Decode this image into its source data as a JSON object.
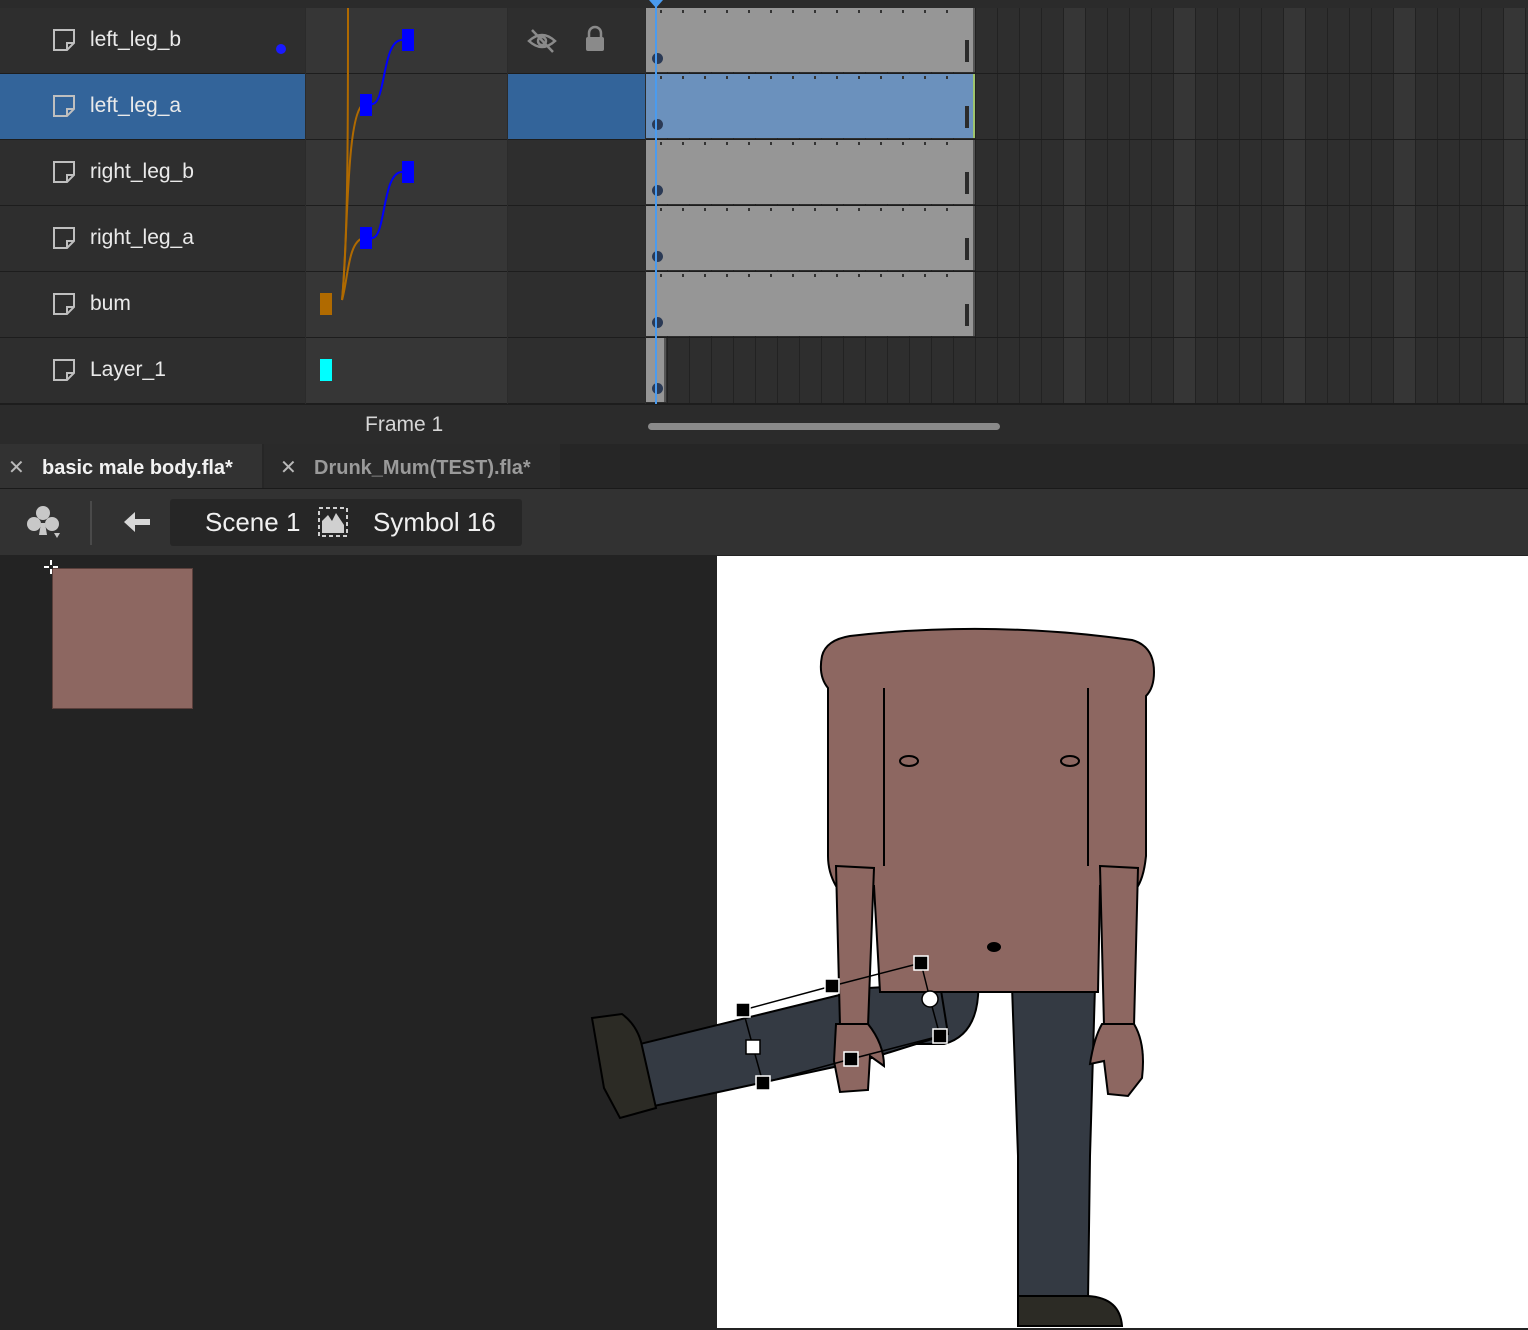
{
  "timeline": {
    "layers": [
      {
        "name": "left_leg_b",
        "selected": false,
        "has_dot": true
      },
      {
        "name": "left_leg_a",
        "selected": true,
        "has_dot": false
      },
      {
        "name": "right_leg_b",
        "selected": false,
        "has_dot": false
      },
      {
        "name": "right_leg_a",
        "selected": false,
        "has_dot": false
      },
      {
        "name": "bum",
        "selected": false,
        "has_dot": false
      },
      {
        "name": "Layer_1",
        "selected": false,
        "has_dot": false
      }
    ],
    "frame_label": "Frame  1",
    "colors": {
      "bone_blue": "#0000ff",
      "bone_orange": "#b06a00",
      "layer1_marker": "#00ffff",
      "playhead": "#4a9bef",
      "selected_row": "#33649a"
    },
    "icons": {
      "visibility": "eye-hidden-icon",
      "lock": "lock-icon",
      "layer": "layer-icon"
    }
  },
  "tabs": [
    {
      "label": "basic male body.fla*",
      "active": true
    },
    {
      "label": "Drunk_Mum(TEST).fla*",
      "active": false
    }
  ],
  "edit_bar": {
    "scene_label": "Scene 1",
    "symbol_label": "Symbol 16",
    "icons": {
      "edit_symbols": "club-icon",
      "back": "arrow-left-icon",
      "symbol": "movieclip-icon"
    }
  },
  "stage": {
    "background": "#ffffff",
    "skin_color": "#8d6761",
    "pants_color": "#343a43",
    "shoe_color": "#2c2b25"
  }
}
